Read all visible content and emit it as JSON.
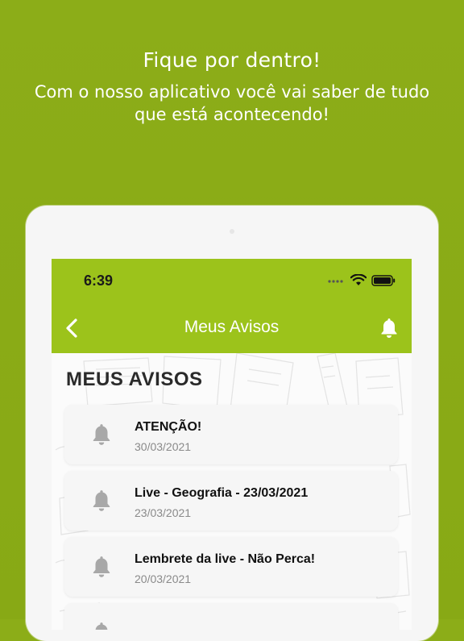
{
  "promo": {
    "title": "Fique por dentro!",
    "subtitle": "Com o nosso aplicativo você vai saber de tudo que está acontecendo!"
  },
  "status_bar": {
    "time": "6:39",
    "icons": [
      "signal-dots-icon",
      "wifi-icon",
      "battery-icon"
    ]
  },
  "nav": {
    "title": "Meus Avisos",
    "back_icon": "chevron-left-icon",
    "notifications_icon": "bell-icon"
  },
  "section": {
    "title": "MEUS AVISOS"
  },
  "notices": [
    {
      "title": "ATENÇÃO!",
      "date": "30/03/2021",
      "icon": "bell-icon"
    },
    {
      "title": "Live - Geografia - 23/03/2021",
      "date": "23/03/2021",
      "icon": "bell-icon"
    },
    {
      "title": "Lembrete da live - Não Perca!",
      "date": "20/03/2021",
      "icon": "bell-icon"
    },
    {
      "title": "",
      "date": "",
      "icon": "bell-icon"
    }
  ],
  "colors": {
    "background": "#8aab17",
    "app_bar": "#9cc31b",
    "card": "#f6f6f6",
    "icon_gray": "#a8a8a8"
  }
}
